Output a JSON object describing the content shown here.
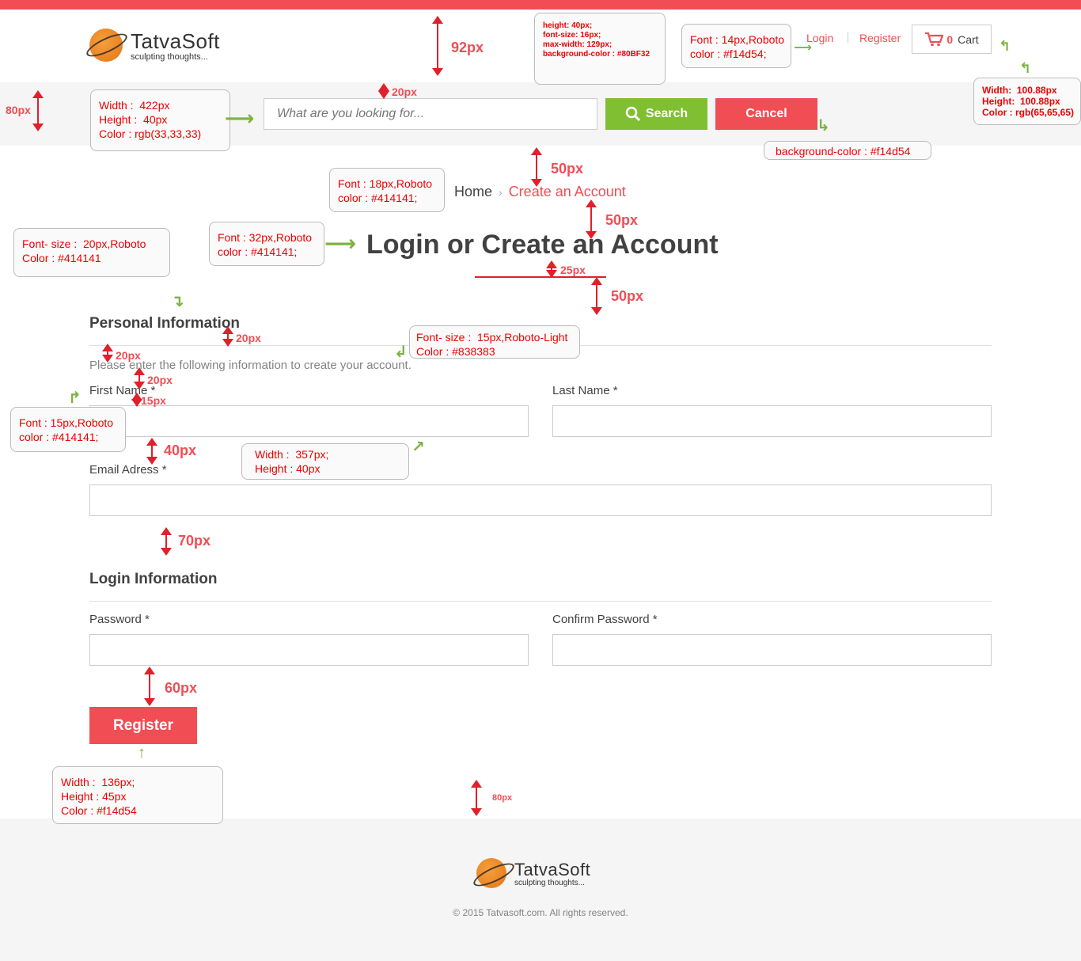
{
  "header": {
    "logo_name": "TatvaSoft",
    "logo_tagline": "sculpting thoughts...",
    "login": "Login",
    "register": "Register",
    "cart_count": "0",
    "cart_label": "Cart"
  },
  "search": {
    "placeholder": "What are you looking for...",
    "search_label": "Search",
    "cancel_label": "Cancel"
  },
  "breadcrumb": {
    "home": "Home",
    "separator": "›",
    "current": "Create an Account"
  },
  "page_title": "Login or Create an Account",
  "personal": {
    "title": "Personal Information",
    "subtitle": "Please enter the following information to create your account.",
    "first_name": "First Name *",
    "last_name": "Last Name *",
    "email": "Email Adress *"
  },
  "login_info": {
    "title": "Login Information",
    "password": "Password *",
    "confirm_password": "Confirm Password *",
    "register_button": "Register"
  },
  "footer": {
    "logo_name": "TatvaSoft",
    "logo_tagline": "sculpting thoughts...",
    "copyright": "© 2015 Tatvasoft.com. All rights reserved."
  },
  "annotations": {
    "search_btn_spec": "height: 40px;\nfont-size: 16px;\nmax-width: 129px;\nbackground-color : #80BF32",
    "header_font": "Font : 14px,Roboto\ncolor : #f14d54;",
    "cart_spec": "Width:  100.88px\nHeight:  100.88px\nColor : rgb(65,65,65)",
    "search_input_spec": "Width :  422px\nHeight :  40px\nColor : rgb(33,33,33)",
    "cancel_spec": "background-color : #f14d54",
    "breadcrumb_spec": "Font : 18px,Roboto\ncolor : #414141;",
    "title_spec": "Font : 32px,Roboto\ncolor : #414141;",
    "section_spec": "Font- size :  20px,Roboto\nColor : #414141",
    "subtitle_spec": "Font- size :  15px,Roboto-Light\nColor : #838383",
    "label_spec": "Font : 15px,Roboto\ncolor : #414141;",
    "field_spec": "Width :  357px;\nHeight : 40px",
    "register_spec": "Width :  136px;\nHeight : 45px\nColor : #f14d54",
    "d92": "92px",
    "d80": "80px",
    "d20a": "20px",
    "d50a": "50px",
    "d50b": "50px",
    "d25": "25px",
    "d50c": "50px",
    "d20b": "20px",
    "d20c": "20px",
    "d20d": "20px",
    "d15": "15px",
    "d40": "40px",
    "d70": "70px",
    "d60": "60px",
    "d80b": "80px"
  }
}
